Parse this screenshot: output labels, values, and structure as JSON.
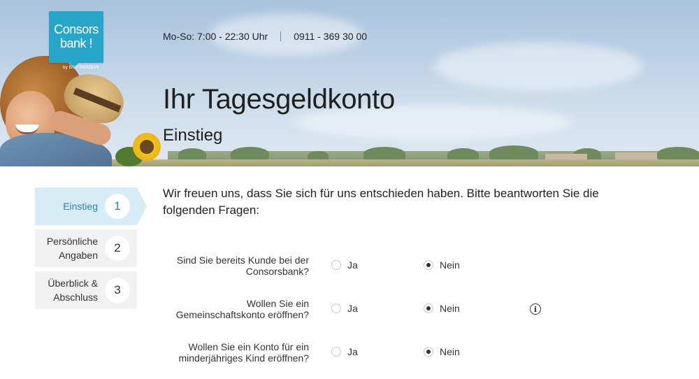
{
  "brand": {
    "logo_line1": "Consors",
    "logo_line2": "bank !",
    "logo_sub": "by BNP PARIBAS",
    "color": "#28a6c9"
  },
  "header": {
    "hours": "Mo-So: 7:00 - 22:30 Uhr",
    "phone": "0911 - 369 30 00",
    "title": "Ihr Tagesgeldkonto",
    "subtitle": "Einstieg"
  },
  "steps": [
    {
      "label": "Einstieg",
      "number": "1",
      "active": true
    },
    {
      "label_line1": "Persönliche",
      "label_line2": "Angaben",
      "number": "2",
      "active": false
    },
    {
      "label_line1": "Überblick &",
      "label_line2": "Abschluss",
      "number": "3",
      "active": false
    }
  ],
  "intro": "Wir freuen uns, dass Sie sich für uns entschieden haben. Bitte beantworten Sie die folgenden Fragen:",
  "questions": [
    {
      "line1": "Sind Sie bereits Kunde bei der",
      "line2": "Consorsbank?",
      "yes": "Ja",
      "no": "Nein",
      "selected": "no",
      "info": false
    },
    {
      "line1": "Wollen Sie ein",
      "line2": "Gemeinschaftskonto eröffnen?",
      "yes": "Ja",
      "no": "Nein",
      "selected": "no",
      "info": true
    },
    {
      "line1": "Wollen Sie ein Konto für ein",
      "line2": "minderjähriges Kind eröffnen?",
      "yes": "Ja",
      "no": "Nein",
      "selected": "no",
      "info": false
    }
  ],
  "icons": {
    "info": "info-icon"
  },
  "colors": {
    "active_step_bg": "#d7edf5",
    "active_step_text": "#2f83a8",
    "inactive_step_bg": "#f1f1f1"
  }
}
